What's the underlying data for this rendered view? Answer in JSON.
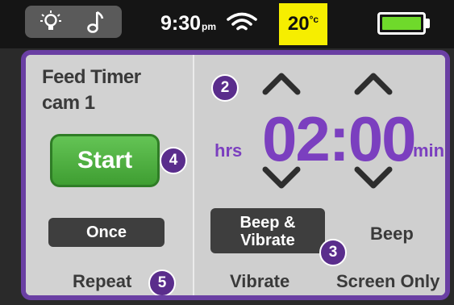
{
  "status_bar": {
    "bulb_icon": "lightbulb-icon",
    "music_icon": "music-note-icon",
    "time": "9:30",
    "time_suffix": "pm",
    "wifi_icon": "wifi-icon",
    "temperature": "20",
    "temperature_unit": "°c",
    "battery_icon": "battery-icon",
    "battery_level": 1.0,
    "temp_highlight_color": "#f6ee00",
    "battery_color": "#6fd92b"
  },
  "timer": {
    "title_line1": "Feed Timer",
    "title_line2": "cam 1",
    "start_label": "Start",
    "once_label": "Once",
    "repeat_label": "Repeat",
    "hours_unit": "hrs",
    "minutes_unit": "mins",
    "time_value": "02:00",
    "accent_color": "#7b3fbf",
    "start_color": "#4caf3e"
  },
  "alert_options": {
    "beep_vibrate_line1": "Beep &",
    "beep_vibrate_line2": "Vibrate",
    "beep": "Beep",
    "vibrate": "Vibrate",
    "screen_only": "Screen Only",
    "selected": "Beep & Vibrate"
  },
  "callouts": {
    "hours_minutes": "2",
    "alert_mode": "3",
    "start": "4",
    "repeat": "5"
  }
}
